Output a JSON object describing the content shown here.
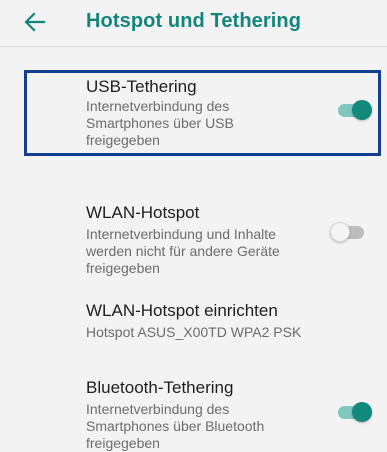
{
  "header": {
    "back_icon": "arrow-left-icon",
    "title": "Hotspot und Tethering"
  },
  "settings": [
    {
      "title": "USB-Tethering",
      "subtitle_lines": [
        "Internetverbindung des",
        "Smartphones über USB",
        "freigegeben"
      ],
      "toggle": "on",
      "highlighted": true
    },
    {
      "title": "WLAN-Hotspot",
      "subtitle_lines": [
        "Internetverbindung und Inhalte",
        "werden nicht für andere Geräte",
        "freigegeben"
      ],
      "toggle": "off"
    },
    {
      "title": "WLAN-Hotspot einrichten",
      "subtitle_lines": [
        "Hotspot ASUS_X00TD WPA2 PSK"
      ]
    },
    {
      "title": "Bluetooth-Tethering",
      "subtitle_lines": [
        "Internetverbindung des",
        "Smartphones über Bluetooth",
        "freigegeben"
      ],
      "toggle": "on"
    }
  ],
  "colors": {
    "accent": "#13897d",
    "highlight_border": "#123f8f"
  }
}
